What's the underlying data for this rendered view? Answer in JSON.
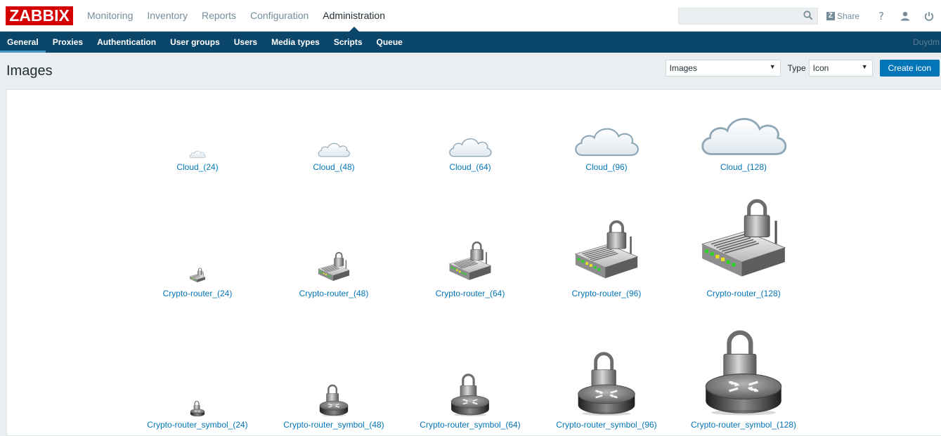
{
  "app": {
    "logo": "ZABBIX",
    "top_menu": [
      {
        "label": "Monitoring",
        "active": false
      },
      {
        "label": "Inventory",
        "active": false
      },
      {
        "label": "Reports",
        "active": false
      },
      {
        "label": "Configuration",
        "active": false
      },
      {
        "label": "Administration",
        "active": true
      }
    ],
    "search": {
      "placeholder": "",
      "value": ""
    },
    "share_label": "Share",
    "help_label": "?",
    "user_label": "Duydm"
  },
  "sub_menu": [
    {
      "label": "General",
      "active": true
    },
    {
      "label": "Proxies",
      "active": false
    },
    {
      "label": "Authentication",
      "active": false
    },
    {
      "label": "User groups",
      "active": false
    },
    {
      "label": "Users",
      "active": false
    },
    {
      "label": "Media types",
      "active": false
    },
    {
      "label": "Scripts",
      "active": false
    },
    {
      "label": "Queue",
      "active": false
    }
  ],
  "page": {
    "title": "Images",
    "section_select": "Images",
    "type_label": "Type",
    "type_select": "Icon",
    "create_button": "Create icon"
  },
  "images": [
    {
      "name": "Cloud_(24)",
      "icon": "cloud",
      "size": 24
    },
    {
      "name": "Cloud_(48)",
      "icon": "cloud",
      "size": 48
    },
    {
      "name": "Cloud_(64)",
      "icon": "cloud",
      "size": 64
    },
    {
      "name": "Cloud_(96)",
      "icon": "cloud",
      "size": 96
    },
    {
      "name": "Cloud_(128)",
      "icon": "cloud",
      "size": 128
    },
    {
      "name": "Crypto-router_(24)",
      "icon": "crypto-router",
      "size": 24
    },
    {
      "name": "Crypto-router_(48)",
      "icon": "crypto-router",
      "size": 48
    },
    {
      "name": "Crypto-router_(64)",
      "icon": "crypto-router",
      "size": 64
    },
    {
      "name": "Crypto-router_(96)",
      "icon": "crypto-router",
      "size": 96
    },
    {
      "name": "Crypto-router_(128)",
      "icon": "crypto-router",
      "size": 128
    },
    {
      "name": "Crypto-router_symbol_(24)",
      "icon": "crypto-router-symbol",
      "size": 24
    },
    {
      "name": "Crypto-router_symbol_(48)",
      "icon": "crypto-router-symbol",
      "size": 48
    },
    {
      "name": "Crypto-router_symbol_(64)",
      "icon": "crypto-router-symbol",
      "size": 64
    },
    {
      "name": "Crypto-router_symbol_(96)",
      "icon": "crypto-router-symbol",
      "size": 96
    },
    {
      "name": "Crypto-router_symbol_(128)",
      "icon": "crypto-router-symbol",
      "size": 128
    }
  ]
}
